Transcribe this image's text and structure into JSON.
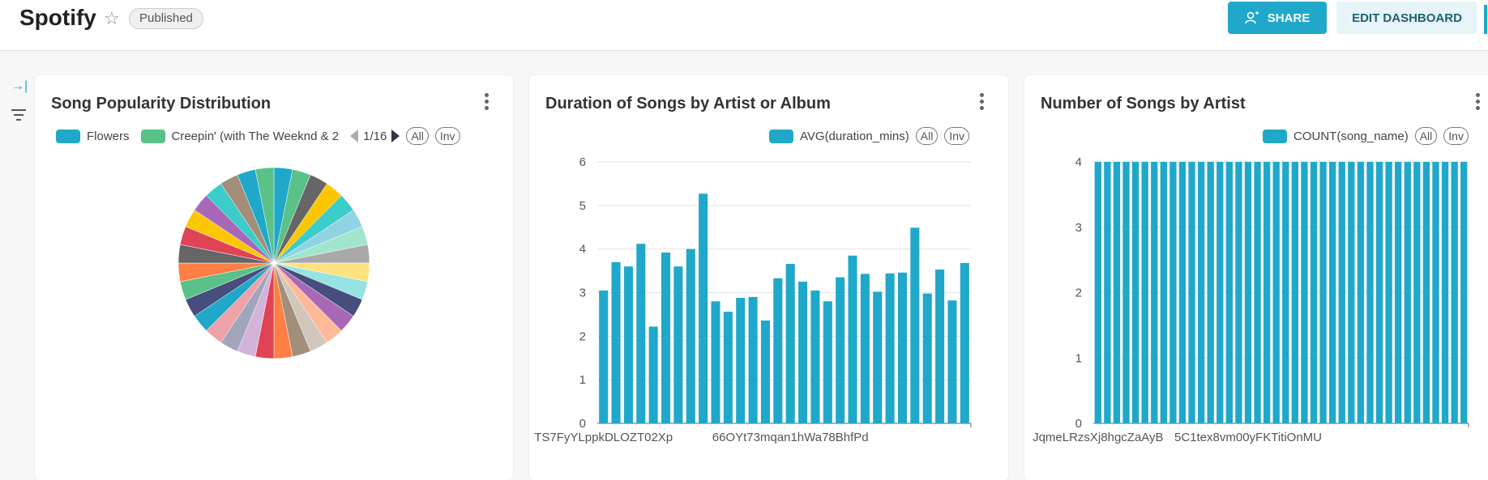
{
  "header": {
    "title": "Spotify",
    "badge": "Published",
    "share_label": "SHARE",
    "edit_label": "EDIT DASHBOARD",
    "accent": "#1fa8c9"
  },
  "sidebar": {
    "icons": [
      "expand-icon",
      "filter-icon"
    ]
  },
  "cards": {
    "pie": {
      "title": "Song Popularity Distribution",
      "legend_items": [
        {
          "label": "Flowers",
          "color": "#1fa8c9"
        },
        {
          "label": "Creepin' (with The Weeknd & 2",
          "color": "#5ac189"
        }
      ],
      "pager": "1/16",
      "all_label": "All",
      "inv_label": "Inv"
    },
    "duration": {
      "title": "Duration of Songs by Artist or Album",
      "legend_label": "AVG(duration_mins)",
      "all_label": "All",
      "inv_label": "Inv"
    },
    "count": {
      "title": "Number of Songs by Artist",
      "legend_label": "COUNT(song_name)",
      "all_label": "All",
      "inv_label": "Inv"
    }
  },
  "chart_data": [
    {
      "type": "pie",
      "title": "Song Popularity Distribution",
      "slices": 32,
      "values": [
        1,
        1,
        1,
        1,
        1,
        1,
        1,
        1,
        1,
        1,
        1,
        1,
        1,
        1,
        1,
        1,
        1,
        1,
        1,
        1,
        1,
        1,
        1,
        1,
        1,
        1,
        1,
        1,
        1,
        1,
        1,
        1
      ],
      "colors": [
        "#1fa8c9",
        "#5ac189",
        "#666666",
        "#fcc700",
        "#3cccca",
        "#8fd3e4",
        "#a1e5cc",
        "#a9a9a9",
        "#fde380",
        "#95e3e2",
        "#454e7c",
        "#a868b7",
        "#feb99b",
        "#d1c6bc",
        "#a38f79",
        "#ff7f44",
        "#e04355",
        "#d3b3da",
        "#a1a6bd",
        "#efa1aa",
        "#1fa8c9",
        "#454e7c",
        "#5ac189",
        "#ff7f44",
        "#666666",
        "#e04355",
        "#fcc700",
        "#a868b7",
        "#3cccca",
        "#a38f79",
        "#1fa8c9",
        "#5ac189"
      ],
      "legend": [
        "Flowers",
        "Creepin' (with The Weeknd & 2"
      ]
    },
    {
      "type": "bar",
      "title": "Duration of Songs by Artist or Album",
      "series": [
        {
          "name": "AVG(duration_mins)",
          "values": [
            3.05,
            3.7,
            3.6,
            4.12,
            2.22,
            3.92,
            3.6,
            4.0,
            5.27,
            2.8,
            2.56,
            2.88,
            2.9,
            2.36,
            3.33,
            3.66,
            3.25,
            3.05,
            2.8,
            3.35,
            3.85,
            3.43,
            3.02,
            3.44,
            3.46,
            4.49,
            2.98,
            3.53,
            2.82,
            3.68
          ]
        }
      ],
      "ylim": [
        0,
        6
      ],
      "yticks": [
        0,
        1,
        2,
        3,
        4,
        5,
        6
      ],
      "xtick_labels": [
        {
          "index": 0,
          "label": "TS7FyYLppkDLOZT02Xp"
        },
        {
          "index": 15,
          "label": "66OYt73mqan1hWa78BhfPd"
        }
      ],
      "color": "#1fa8c9",
      "grid": true
    },
    {
      "type": "bar",
      "title": "Number of Songs by Artist",
      "series": [
        {
          "name": "COUNT(song_name)",
          "values": [
            4,
            4,
            4,
            4,
            4,
            4,
            4,
            4,
            4,
            4,
            4,
            4,
            4,
            4,
            4,
            4,
            4,
            4,
            4,
            4,
            4,
            4,
            4,
            4,
            4,
            4,
            4,
            4,
            4,
            4,
            4,
            4,
            4,
            4,
            4,
            4,
            4,
            4,
            4,
            4
          ]
        }
      ],
      "ylim": [
        0,
        4
      ],
      "yticks": [
        0,
        1,
        2,
        3,
        4
      ],
      "xtick_labels": [
        {
          "index": 0,
          "label": "JqmeLRzsXj8hgcZaAyB"
        },
        {
          "index": 16,
          "label": "5C1tex8vm00yFKTitiOnMU"
        }
      ],
      "color": "#1fa8c9",
      "grid": true
    }
  ]
}
